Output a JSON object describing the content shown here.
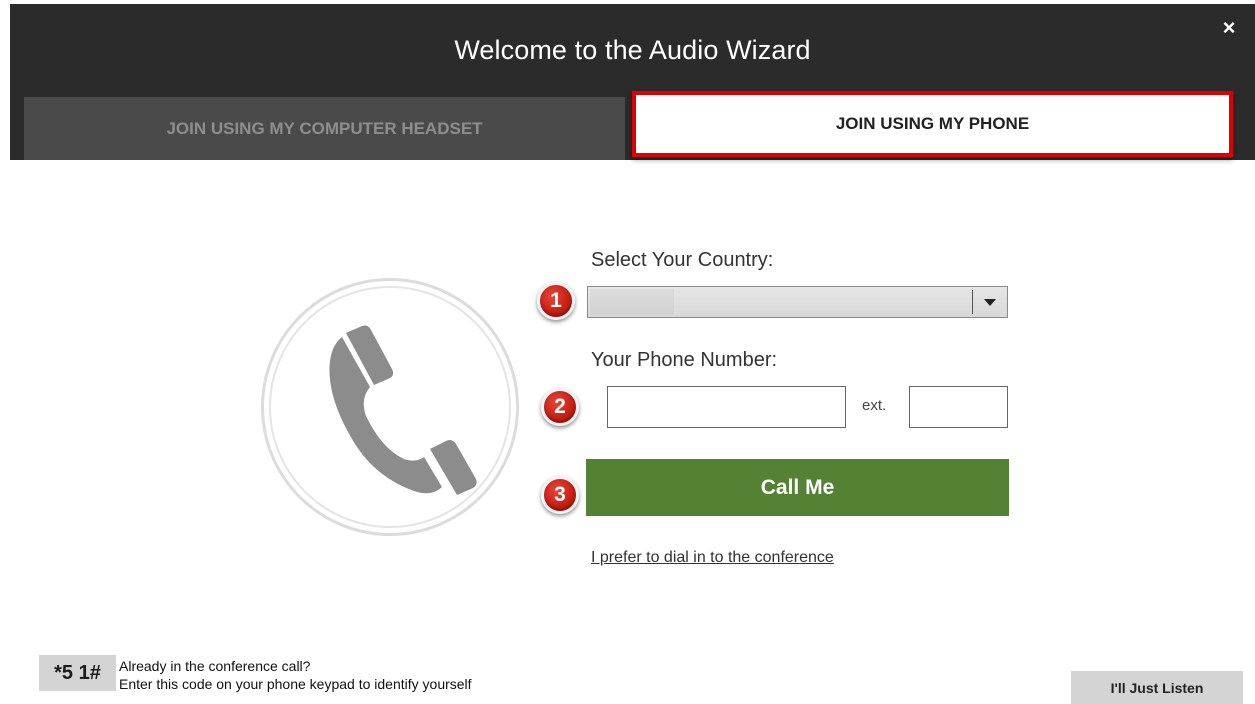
{
  "dialog": {
    "title": "Welcome to the Audio Wizard",
    "close_symbol": "×"
  },
  "tabs": [
    {
      "label": "JOIN USING MY COMPUTER HEADSET",
      "selected": false
    },
    {
      "label": "JOIN USING MY PHONE",
      "selected": true,
      "highlight_color": "#e00000"
    }
  ],
  "illustration": {
    "icon": "phone-handset-icon"
  },
  "form": {
    "country_label": "Select Your Country:",
    "country_value": "",
    "phone_label": "Your Phone Number:",
    "phone_value": "",
    "ext_label": "ext.",
    "ext_value": "",
    "call_button_label": "Call Me",
    "dial_in_link": "I prefer to dial in to the conference"
  },
  "steps": [
    "1",
    "2",
    "3"
  ],
  "footer": {
    "code": "*5 1#",
    "already_title": "Already in the conference call?",
    "already_subtitle": "Enter this code on your phone keypad to identify yourself",
    "listen_button_label": "I'll Just Listen"
  },
  "colors": {
    "header_bg": "#2b2b2b",
    "call_button_bg": "#548235",
    "badge_red": "#c41d12"
  }
}
